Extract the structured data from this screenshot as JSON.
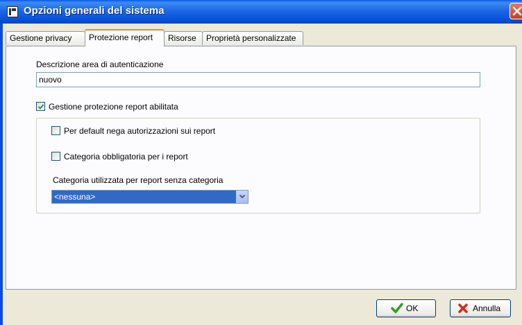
{
  "window": {
    "title": "Opzioni generali del sistema"
  },
  "tabs": [
    {
      "label": "Gestione privacy",
      "active": false
    },
    {
      "label": "Protezione report",
      "active": true
    },
    {
      "label": "Risorse",
      "active": false
    },
    {
      "label": "Proprietà personalizzate",
      "active": false
    }
  ],
  "panel": {
    "auth_area": {
      "label": "Descrizione area di autenticazione",
      "value": "nuovo"
    },
    "protection_enabled": {
      "label": "Gestione protezione report abilitata",
      "checked": true
    },
    "deny_default": {
      "label": "Per default nega autorizzazioni sui report",
      "checked": false
    },
    "category_required": {
      "label": "Categoria obbligatoria per i report",
      "checked": false
    },
    "default_category": {
      "label": "Categoria utilizzata per report senza categoria",
      "value": "<nessuna>"
    }
  },
  "buttons": {
    "ok": "OK",
    "cancel": "Annulla"
  },
  "icons": {
    "app": "app-logo-icon",
    "close": "close-icon",
    "ok": "checkmark-icon",
    "cancel": "x-mark-icon",
    "dropdown": "chevron-down-icon"
  },
  "colors": {
    "title_bar": "#0a58e0",
    "active_tab_accent": "#e68b2c",
    "selection": "#316ac5",
    "ok_check": "#2e9e1f",
    "cancel_x": "#d42b1c"
  }
}
